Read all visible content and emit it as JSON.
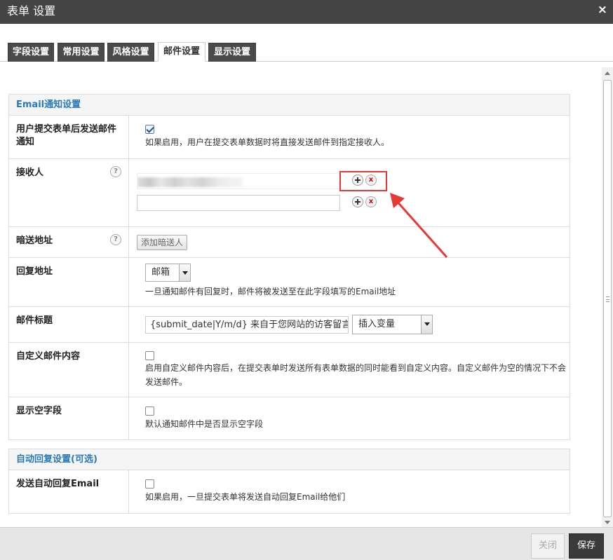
{
  "window": {
    "title": "表单 设置",
    "close_glyph": "×"
  },
  "tabs": [
    {
      "label": "字段设置"
    },
    {
      "label": "常用设置"
    },
    {
      "label": "风格设置"
    },
    {
      "label": "邮件设置",
      "active": true
    },
    {
      "label": "显示设置"
    }
  ],
  "email_section": {
    "title": "Email通知设置",
    "notify": {
      "label": "用户提交表单后发送邮件通知",
      "checked": true,
      "desc": "如果启用，用户在提交表单数据时将直接发送邮件到指定接收人。"
    },
    "recipient": {
      "label": "接收人",
      "help": "?",
      "add_glyph": "+",
      "del_glyph": "x"
    },
    "bcc": {
      "label": "暗送地址",
      "help": "?",
      "add_button": "添加暗送人"
    },
    "reply": {
      "label": "回复地址",
      "select_value": "邮箱",
      "desc": "一旦通知邮件有回复时，邮件将被发送至在此字段填写的Email地址"
    },
    "subject": {
      "label": "邮件标题",
      "value": "{submit_date|Y/m/d} 来自于您网站的访客留言",
      "insert_var": "插入变量"
    },
    "custom_content": {
      "label": "自定义邮件内容",
      "checked": false,
      "desc_line1": "启用自定义邮件内容后，在提交表单时发送所有表单数据的同时能看到自定义内容。自定义邮件为空的情况下不会",
      "desc_line2": "发送邮件。"
    },
    "show_empty": {
      "label": "显示空字段",
      "checked": false,
      "desc": "默认通知邮件中是否显示空字段"
    }
  },
  "auto_reply_section": {
    "title": "自动回复设置(可选)",
    "send_auto_reply": {
      "label": "发送自动回复Email",
      "checked": false,
      "desc": "如果启用，一旦提交表单将发送自动回复Email给他们"
    }
  },
  "footer": {
    "close_label": "关闭",
    "save_label": "保存"
  },
  "colors": {
    "accent": "#2a7ab8",
    "highlight": "#e53935",
    "titlebar": "#444444"
  }
}
